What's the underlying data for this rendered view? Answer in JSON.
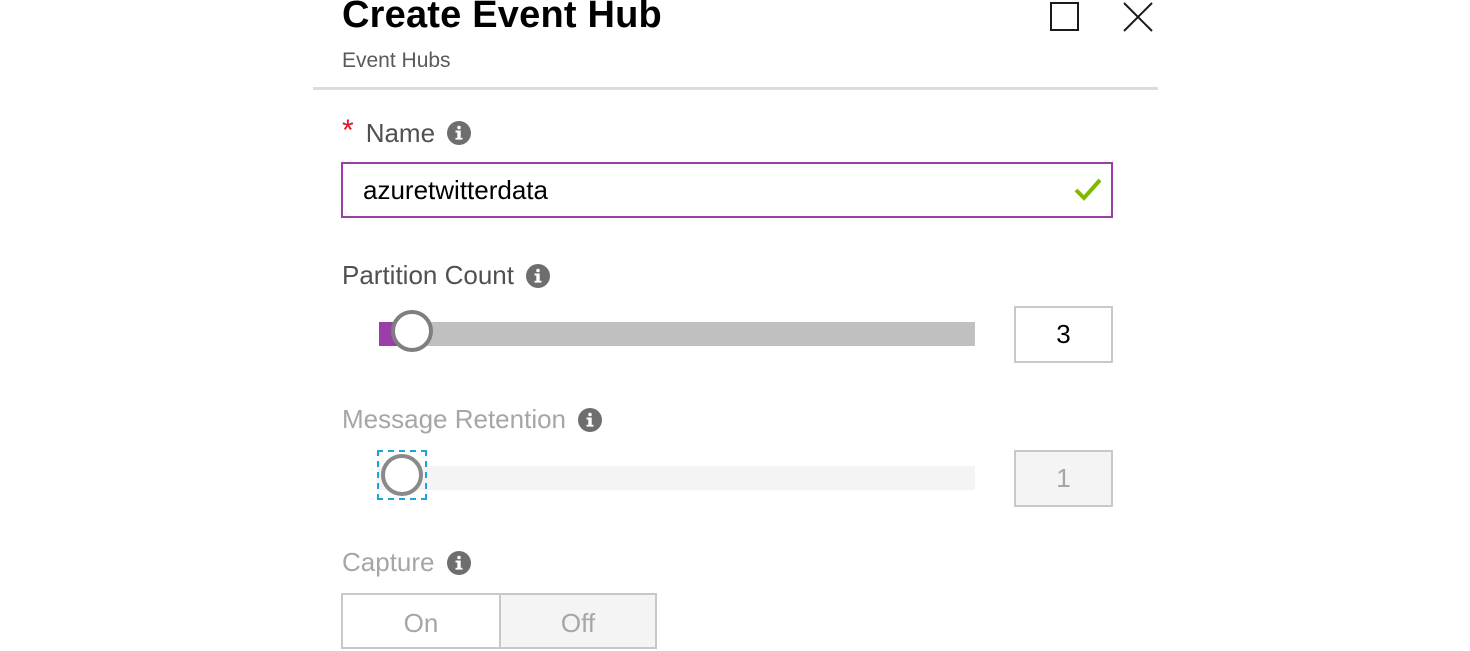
{
  "header": {
    "title": "Create Event Hub",
    "subtitle": "Event Hubs",
    "maximize_icon": "maximize-icon",
    "close_icon": "close-icon"
  },
  "colors": {
    "accent": "#9b3ea9",
    "required": "#e81123",
    "valid": "#7fba00",
    "focus": "#1aa6d8",
    "label": "#505050",
    "disabled_text": "#a6a6a6"
  },
  "form": {
    "name": {
      "label": "Name",
      "required_marker": "*",
      "value": "azuretwitterdata",
      "placeholder": "",
      "valid": true,
      "info_icon": "info-icon",
      "valid_icon": "checkmark-icon"
    },
    "partition_count": {
      "label": "Partition Count",
      "value": "3",
      "min": 2,
      "max": 32,
      "slider_fraction": 0.056,
      "disabled": false,
      "info_icon": "info-icon"
    },
    "message_retention": {
      "label": "Message Retention",
      "value": "1",
      "min": 1,
      "max": 7,
      "slider_fraction": 0.0,
      "disabled": true,
      "info_icon": "info-icon"
    },
    "capture": {
      "label": "Capture",
      "options": [
        "On",
        "Off"
      ],
      "selected": "Off",
      "disabled": true,
      "info_icon": "info-icon"
    }
  }
}
